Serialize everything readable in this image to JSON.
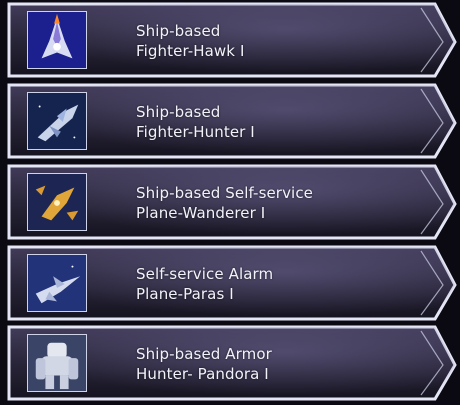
{
  "colors": {
    "panel_top": "#3a354f",
    "panel_bottom": "#1a1826",
    "border": "#e4e6f5",
    "text": "#f2f3fa"
  },
  "ships": [
    {
      "line1": "Ship-based",
      "line2": "Fighter-Hawk I",
      "icon": "fighter-hawk-icon"
    },
    {
      "line1": "Ship-based",
      "line2": "Fighter-Hunter I",
      "icon": "fighter-hunter-icon"
    },
    {
      "line1": "Ship-based Self-service",
      "line2": "Plane-Wanderer I",
      "icon": "plane-wanderer-icon"
    },
    {
      "line1": "Self-service Alarm",
      "line2": "Plane-Paras I",
      "icon": "plane-paras-icon"
    },
    {
      "line1": "Ship-based Armor",
      "line2": "Hunter- Pandora I",
      "icon": "armor-pandora-icon"
    }
  ]
}
